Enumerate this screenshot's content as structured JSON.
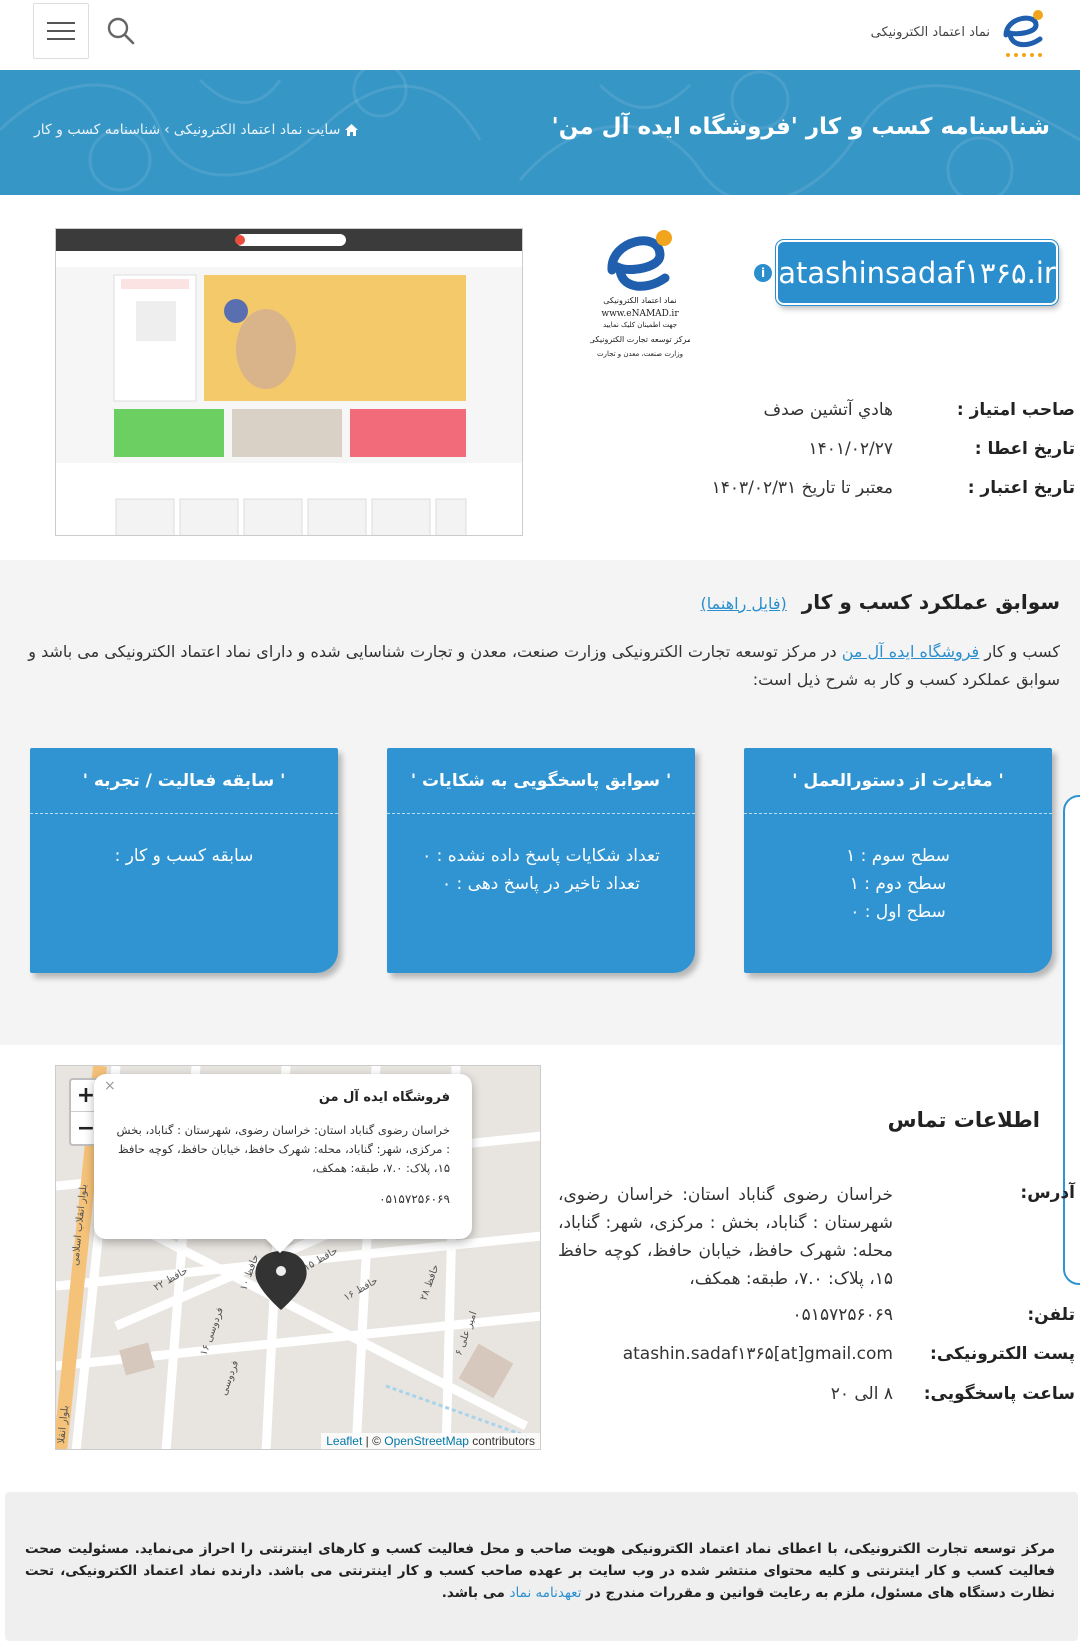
{
  "header": {
    "logo_text": "نماد اعتماد الکترونیکی",
    "logo_small": "www.eNAMAD.ir"
  },
  "banner": {
    "title": "شناسنامه کسب و کار 'فروشگاه ایده آل من'",
    "crumb_home": "سایت نماد اعتماد الکترونیکی",
    "crumb_sep": "›",
    "crumb_current": "شناسنامه کسب و کار"
  },
  "identity": {
    "domain": "atashinsadaf۱۳۶۵.ir",
    "info_icon": "i",
    "badge": {
      "line1": "نماد اعتماد الکترونیکی",
      "line2": "www.eNAMAD.ir",
      "line3": "جهت اطمینان کلیک نمایید",
      "line4": "مرکز توسعه تجارت الکترونیکی",
      "line5": "وزارت صنعت، معدن و تجارت"
    },
    "rows": [
      {
        "label": "صاحب امتیاز :",
        "value": "هادي آتشين صدف"
      },
      {
        "label": "تاریخ اعطا :",
        "value": "۱۴۰۱/۰۲/۲۷"
      },
      {
        "label": "تاریخ اعتبار :",
        "value": "معتبر تا تاریخ ۱۴۰۳/۰۲/۳۱"
      }
    ]
  },
  "performance": {
    "title": "سوابق عملکرد کسب و کار",
    "guide_link": "(فایل راهنما)",
    "desc_prefix": "کسب و کار ",
    "desc_link": "فروشگاه ایده آل من",
    "desc_suffix": " در مرکز توسعه تجارت الکترونیکی وزارت صنعت، معدن و تجارت شناسایی شده و دارای نماد اعتماد الکترونیکی می باشد و سوابق عملکرد کسب و کار به شرح ذیل است:",
    "cards": [
      {
        "title": "' مغایرت از دستورالعمل '",
        "lines": [
          "سطح سوم : ۱",
          "سطح دوم : ۱",
          "سطح اول : ۰"
        ]
      },
      {
        "title": "' سوابق پاسخگویی به شکایات '",
        "lines": [
          "تعداد شکایات پاسخ داده نشده : ۰",
          "تعداد تاخیر در پاسخ دهی : ۰"
        ]
      },
      {
        "title": "' سابقه فعالیت / تجربه '",
        "lines": [
          "سابقه کسب و کار :"
        ]
      }
    ]
  },
  "map": {
    "zoom_in": "+",
    "zoom_out": "−",
    "popup_close": "×",
    "popup_title": "فروشگاه ایده آل من",
    "popup_address": "خراسان رضوی گناباد استان: خراسان رضوی، شهرستان : گناباد، بخش : مرکزی، شهر: گناباد، محله: شهرک حافظ، خیابان حافظ، کوچه حافظ ۱۵، پلاک: ۷.۰، طبقه: همکف،",
    "popup_phone": "۰۵۱۵۷۲۵۶۰۶۹",
    "attrib_leaflet": "Leaflet",
    "attrib_sep": " | © ",
    "attrib_osm": "OpenStreetMap",
    "attrib_suffix": " contributors",
    "streets": [
      "بلوار انقلاب اسلامی",
      "بلوار انقلا",
      "حافظ ۱۵",
      "حافظ ۱۰",
      "حافظ ۱۶",
      "حافظ ۲۸",
      "حافظ ۲۲",
      "امیر علی ۶",
      "فردوسی ۱۶",
      "فردوسی"
    ]
  },
  "contact": {
    "title": "اطلاعات تماس",
    "rows": [
      {
        "label": "آدرس:",
        "value": "خراسان رضوی گناباد استان: خراسان رضوی، شهرستان : گناباد، بخش : مرکزی، شهر: گناباد، محله: شهرک حافظ، خیابان حافظ، کوچه حافظ ۱۵، پلاک: ۷.۰، طبقه: همکف،"
      },
      {
        "label": "تلفن:",
        "value": "۰۵۱۵۷۲۵۶۰۶۹"
      },
      {
        "label": "پست الکترونیکی:",
        "value": "atashin.sadaf۱۳۶۵[at]gmail.com"
      },
      {
        "label": "ساعت پاسخگویی:",
        "value": "۸ الی ۲۰"
      }
    ]
  },
  "footer": {
    "text": "مرکز توسعه تجارت الکترونیکی، با اعطای نماد اعتماد الکترونیکی هویت صاحب و محل فعالیت کسب و کارهای اینترنتی را احراز می‌نماید. مسئولیت صحت فعالیت کسب و کار اینترنتی و کلیه محتوای منتشر شده در وب سایت بر عهده صاحب کسب و کار اینترنتی می باشد. دارنده نماد اعتماد الکترونیکی، تحت نظارت دستگاه های مسئول، ملزم به رعایت قوانین و مقررات مندرج در ",
    "link": "تعهدنامه نماد",
    "suffix": " می باشد."
  },
  "colors": {
    "primary": "#2f94d1",
    "banner": "#3696c6",
    "footer_bg": "#efefef"
  }
}
